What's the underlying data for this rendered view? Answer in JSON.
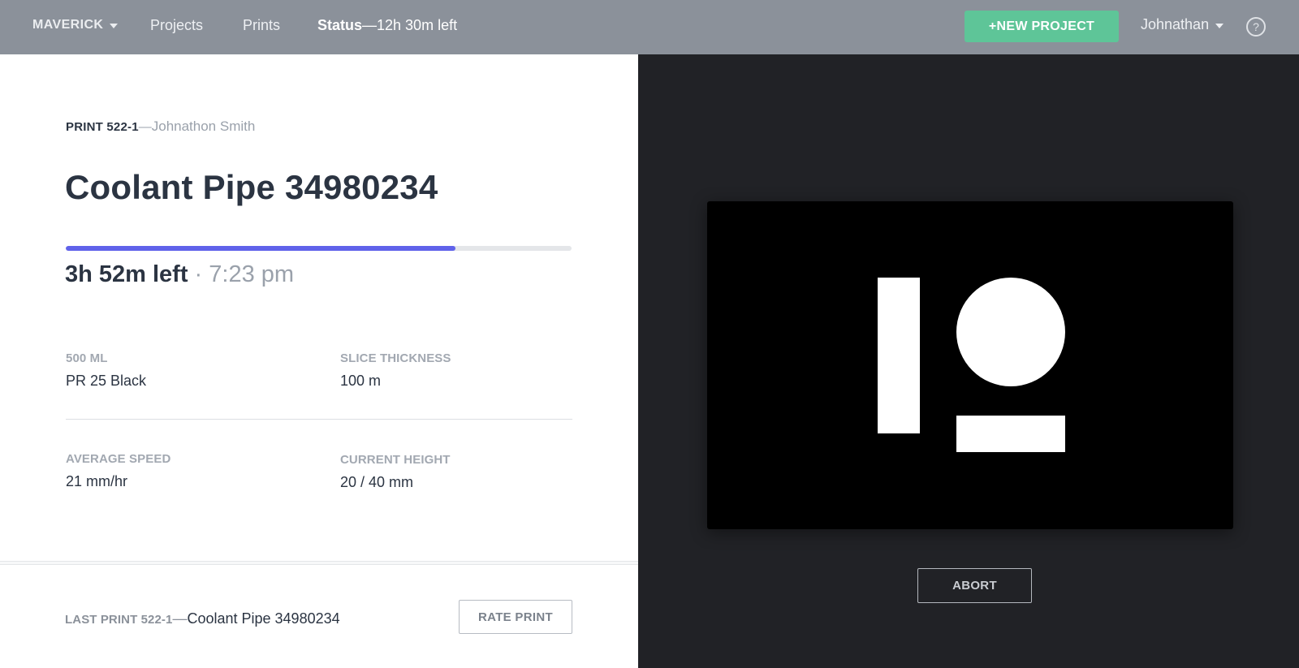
{
  "topbar": {
    "brand": "MAVERICK",
    "nav": [
      "Projects",
      "Prints"
    ],
    "status_label": "Status",
    "status_value": "—12h 30m left",
    "new_project_label": "+NEW PROJECT",
    "user_name": "Johnathan",
    "help_label": "?"
  },
  "print": {
    "id": "PRINT 522-1",
    "separator": "—",
    "owner": "Johnathon Smith",
    "title": "Coolant Pipe 34980234",
    "progress_fraction": 0.77,
    "time_left": "3h 52m left",
    "eta": " · 7:23 pm",
    "progress_color": "#6062ea"
  },
  "stats": [
    {
      "label": "500 ML",
      "value": "PR 25 Black"
    },
    {
      "label": "SLICE THICKNESS",
      "value": "100 m"
    },
    {
      "label": "AVERAGE SPEED",
      "value": "21 mm/hr"
    },
    {
      "label": "CURRENT HEIGHT",
      "value": "20 / 40 mm"
    }
  ],
  "last_print": {
    "id": "LAST PRINT 522-1",
    "separator": "—",
    "name": "Coolant Pipe 34980234",
    "rate_label": "RATE PRINT"
  },
  "preview": {
    "icon": "patreon-logo-icon",
    "abort_label": "ABORT"
  },
  "colors": {
    "topbar_bg": "#8b919a",
    "accent_green": "#5ec598",
    "dark_pane": "#212226"
  }
}
